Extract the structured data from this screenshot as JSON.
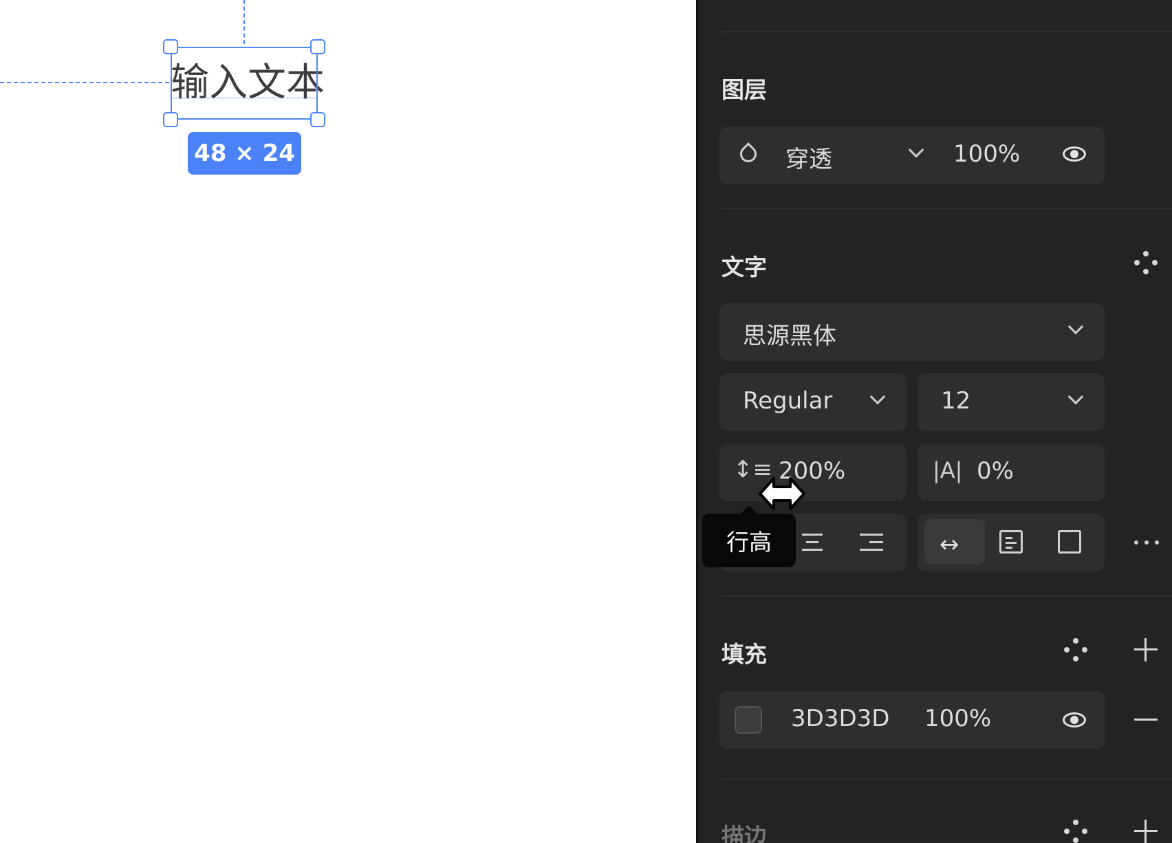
{
  "canvas": {
    "text_content": "输入文本",
    "size_badge": "48 × 24"
  },
  "panel": {
    "layer": {
      "title": "图层",
      "blend_mode": "穿透",
      "opacity": "100%"
    },
    "text": {
      "title": "文字",
      "font_family": "思源黑体",
      "font_weight": "Regular",
      "font_size": "12",
      "line_height": "200%",
      "letter_spacing": "0%",
      "tooltip": "行高"
    },
    "fill": {
      "title": "填充",
      "hex": "3D3D3D",
      "opacity": "100%",
      "color": "#3D3D3D"
    },
    "stroke": {
      "title": "描边"
    }
  }
}
